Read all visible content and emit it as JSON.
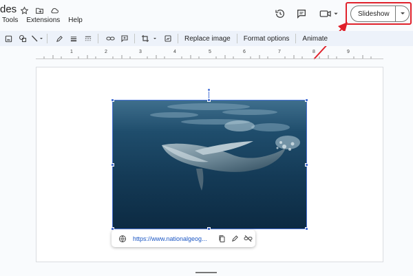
{
  "app": {
    "title_fragment": "des"
  },
  "menu": [
    "Tools",
    "Extensions",
    "Help"
  ],
  "actions": {
    "slideshow_label": "Slideshow"
  },
  "toolbar": {
    "replace_image": "Replace image",
    "format_options": "Format options",
    "animate": "Animate"
  },
  "ruler": {
    "labels": [
      "1",
      "2",
      "3",
      "4",
      "5",
      "6",
      "7",
      "8",
      "9"
    ]
  },
  "link_popup": {
    "url": "https://www.nationalgeog..."
  },
  "colors": {
    "accent": "#4a73d6",
    "highlight": "#e0202a",
    "toolbar_bg": "#edf2fa"
  },
  "icons": [
    "star-icon",
    "move-to-folder-icon",
    "cloud-saved-icon",
    "history-icon",
    "comment-icon",
    "video-call-icon",
    "globe-icon",
    "copy-icon",
    "edit-icon",
    "unlink-icon"
  ]
}
